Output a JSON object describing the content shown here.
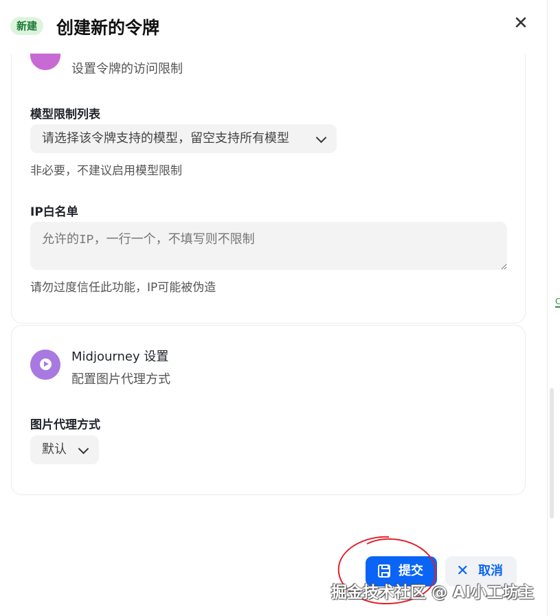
{
  "header": {
    "badge": "新建",
    "title": "创建新的令牌",
    "close_glyph": "✕"
  },
  "access_section": {
    "subtitle": "设置令牌的访问限制",
    "model_limit": {
      "label": "模型限制列表",
      "placeholder": "请选择该令牌支持的模型，留空支持所有模型",
      "hint": "非必要，不建议启用模型限制"
    },
    "ip_whitelist": {
      "label": "IP白名单",
      "placeholder": "允许的IP，一行一个，不填写则不限制",
      "hint": "请勿过度信任此功能，IP可能被伪造"
    }
  },
  "midjourney_section": {
    "title": "Midjourney 设置",
    "subtitle": "配置图片代理方式",
    "proxy": {
      "label": "图片代理方式",
      "value": "默认"
    }
  },
  "footer": {
    "submit_label": "提交",
    "cancel_label": "取消"
  },
  "watermark": "掘金技术社区 @ AI小工坊主",
  "colors": {
    "primary": "#0a64f5",
    "badge_bg": "#dcf4dd",
    "badge_text": "#1f7a35",
    "access_icon": "#c86ad4",
    "midjourney_icon": "#a879e0",
    "annotation": "#e0202a"
  }
}
